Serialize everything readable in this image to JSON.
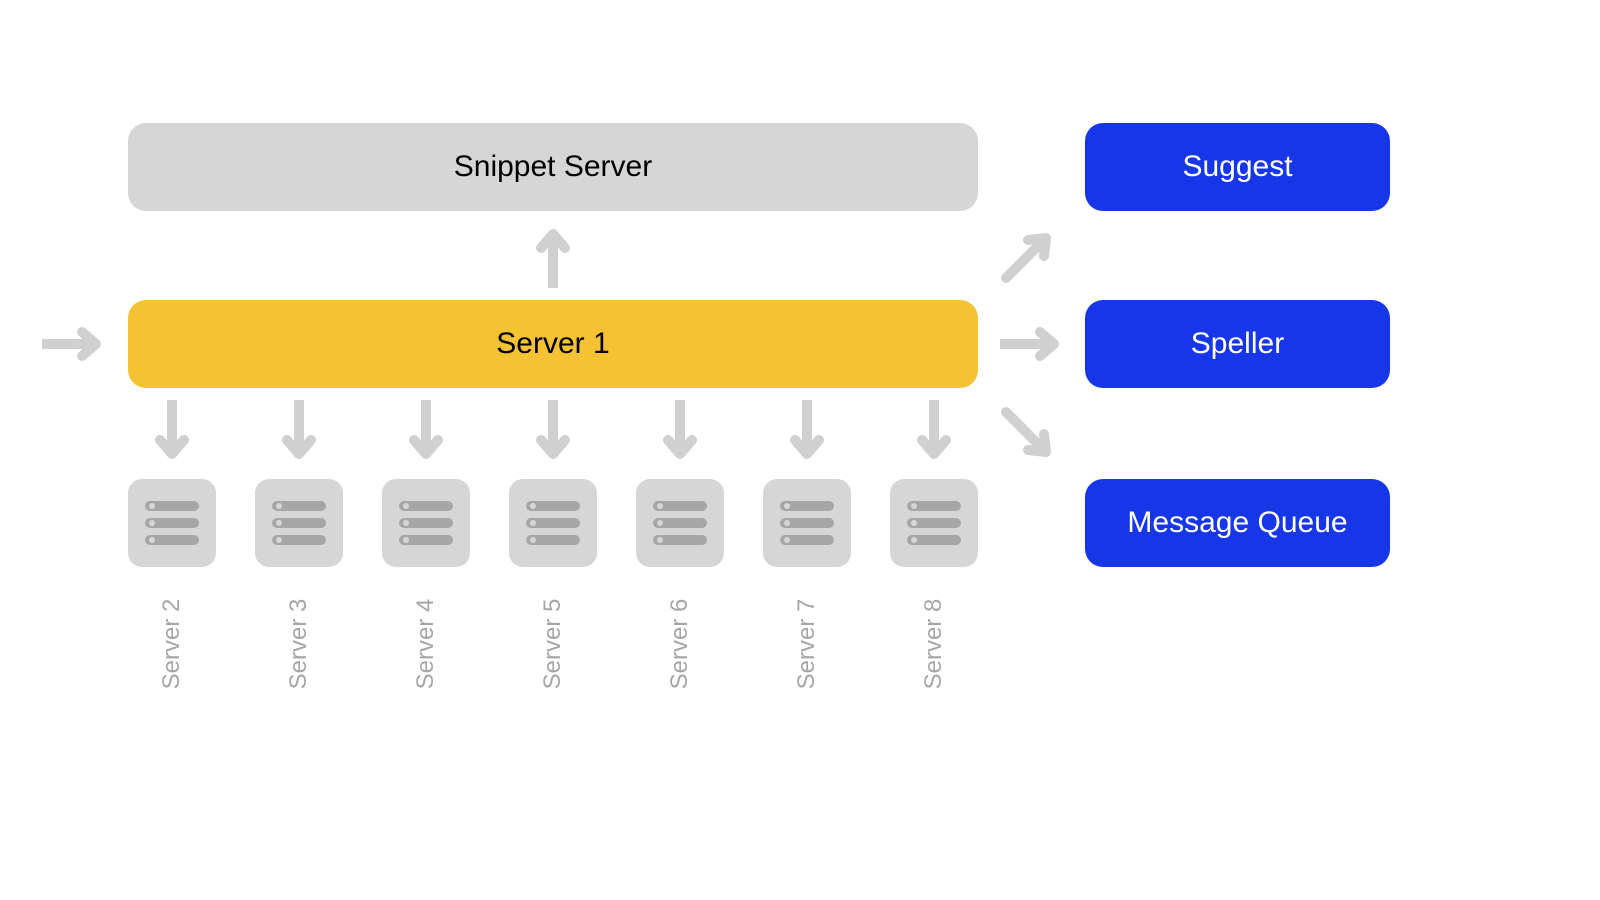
{
  "top": {
    "snippet": "Snippet Server"
  },
  "main": {
    "server1": "Server 1"
  },
  "right": {
    "suggest": "Suggest",
    "speller": "Speller",
    "mq": "Message Queue"
  },
  "servers": [
    "Server 2",
    "Server 3",
    "Server 4",
    "Server 5",
    "Server 6",
    "Server 7",
    "Server 8"
  ]
}
